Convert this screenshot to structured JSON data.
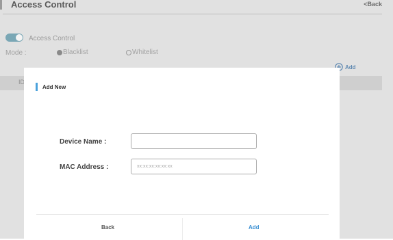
{
  "page": {
    "title": "Access Control",
    "back_label": "<Back"
  },
  "access_control": {
    "toggle_label": "Access Control",
    "toggle_on": true
  },
  "mode": {
    "label": "Mode :",
    "options": [
      {
        "label": "Blacklist",
        "selected": true
      },
      {
        "label": "Whitelist",
        "selected": false
      }
    ]
  },
  "list": {
    "add_label": "Add",
    "column_header": "ID"
  },
  "dialog": {
    "title": "Add New",
    "device_name_label": "Device Name :",
    "device_name_value": "",
    "mac_label": "MAC Address :",
    "mac_placeholder": "xx:xx:xx:xx:xx:xx",
    "back_button": "Back",
    "add_button": "Add"
  },
  "colors": {
    "accent_blue": "#4aa2dc",
    "toggle_teal": "#7aa7b5",
    "overlay_gray": "#e1e1e1"
  },
  "icons": {
    "add": "plus-circle-icon"
  }
}
